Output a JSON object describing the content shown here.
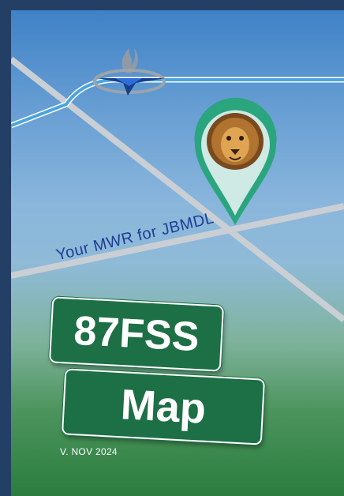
{
  "cover": {
    "tagline": "Your MWR for JBMDL",
    "sign_top": "87FSS",
    "sign_bottom": "Map",
    "version": "V. NOV 2024"
  },
  "icons": {
    "logo": "air-force-flame-logo-icon",
    "pin": "lion-location-pin-icon"
  },
  "colors": {
    "sign_green": "#1d6f46",
    "frame_navy": "#243f66",
    "tagline_blue": "#1e3e93",
    "pin_teal": "#2aa57e"
  }
}
